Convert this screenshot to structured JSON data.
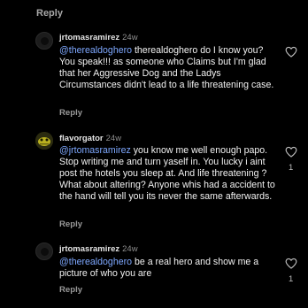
{
  "top_reply": "Reply",
  "comments": [
    {
      "username": "jrtomasramirez",
      "time": "24w",
      "mention": "@therealdoghero",
      "text": " therealdoghero do I know you?  You speak!!! as someone who Claims but I'm glad that her Aggressive Dog and the Ladys Circumstances didn't lead to a life threatening case.",
      "reply": "Reply",
      "likes": "",
      "avatar": "dark-avatar"
    },
    {
      "username": "flavorgator",
      "time": "24w",
      "mention": "@jrtomasramirez",
      "text": " you know me well enough papo. Stop writing me and turn yaself in. You lucky i aint post the hotels you sleep at. And life threatening ? What about altering? Anyone whis had a accident to the hand will tell you its never the same afterwards.",
      "reply": "Reply",
      "likes": "1",
      "avatar": "gator-avatar"
    },
    {
      "username": "jrtomasramirez",
      "time": "24w",
      "mention": "@therealdoghero",
      "text": " be a real hero and show me a picture of who you are",
      "reply": "Reply",
      "likes": "1",
      "avatar": "dark-avatar"
    }
  ]
}
